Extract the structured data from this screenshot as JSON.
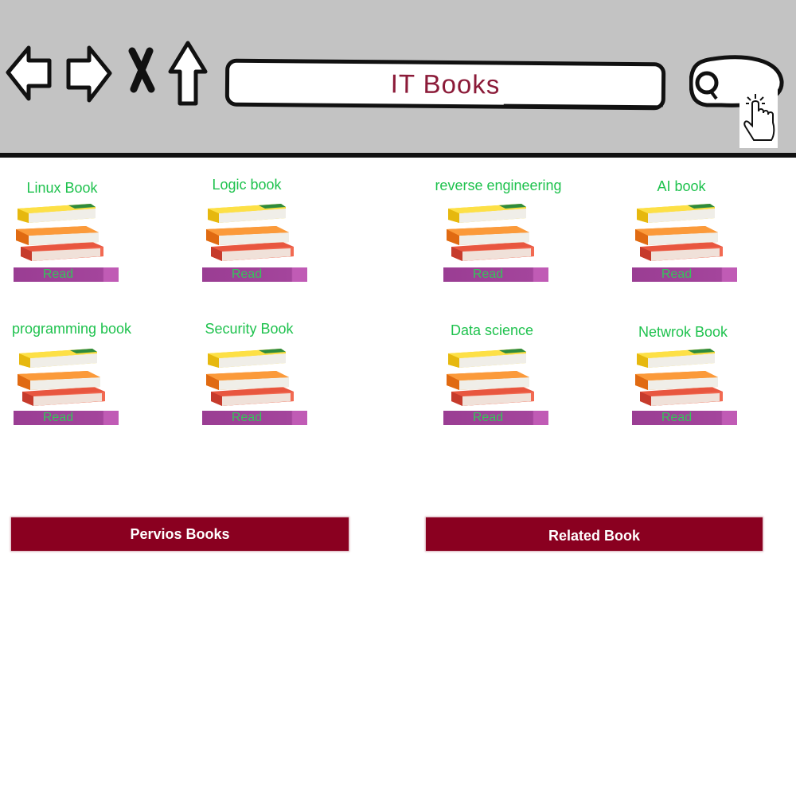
{
  "browser": {
    "address_text": "IT Books",
    "icons": [
      "back-arrow-icon",
      "forward-arrow-icon",
      "close-icon",
      "home-arrow-icon",
      "search-icon",
      "hand-pointer-icon"
    ]
  },
  "books": [
    {
      "title": "Linux Book",
      "read_label": "Read"
    },
    {
      "title": "Logic book",
      "read_label": "Read"
    },
    {
      "title": "reverse engineering",
      "read_label": "Read"
    },
    {
      "title": "AI book",
      "read_label": "Read"
    },
    {
      "title": "programming book",
      "read_label": "Read"
    },
    {
      "title": "Security Book",
      "read_label": "Read"
    },
    {
      "title": "Data science",
      "read_label": "Read"
    },
    {
      "title": "Netwrok Book",
      "read_label": "Read"
    }
  ],
  "footer": {
    "previous_label": "Pervios Books",
    "related_label": "Related Book"
  },
  "colors": {
    "toolbar": "#c3c3c3",
    "title_text": "#8b1a38",
    "book_title": "#1fc24e",
    "read_button": "#a4459c",
    "bottom_button": "#8a0020"
  }
}
